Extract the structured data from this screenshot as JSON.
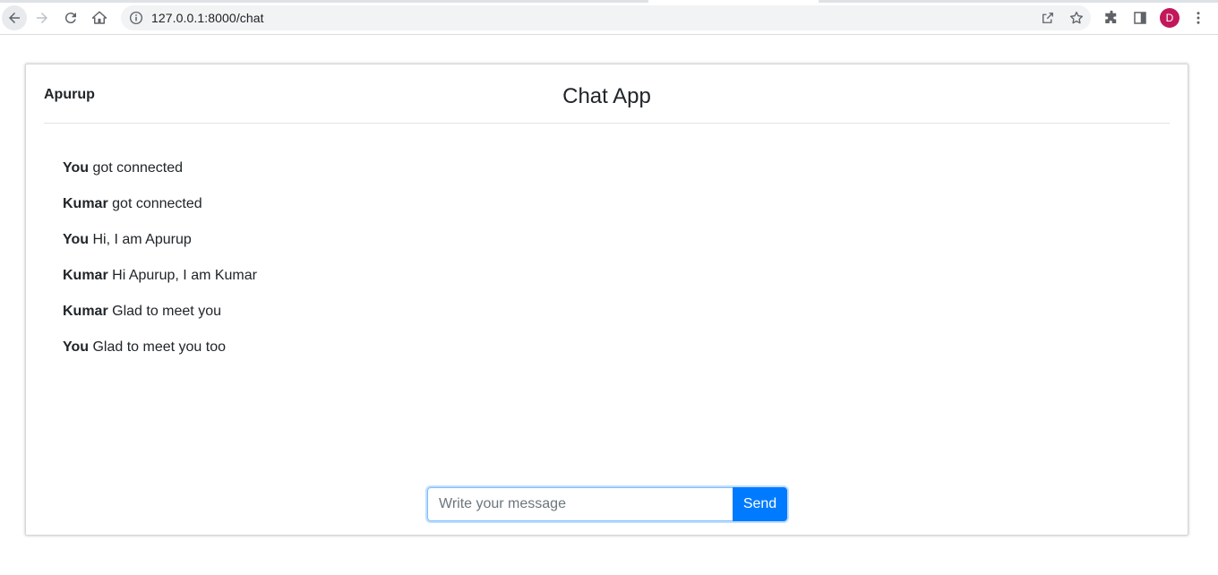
{
  "browser": {
    "url": "127.0.0.1:8000/chat",
    "profile_initial": "D"
  },
  "page": {
    "username": "Apurup",
    "title": "Chat App",
    "messages": [
      {
        "sender": "You",
        "text": "got connected"
      },
      {
        "sender": "Kumar",
        "text": "got connected"
      },
      {
        "sender": "You",
        "text": "Hi, I am Apurup"
      },
      {
        "sender": "Kumar",
        "text": "Hi Apurup, I am Kumar"
      },
      {
        "sender": "Kumar",
        "text": "Glad to meet you"
      },
      {
        "sender": "You",
        "text": "Glad to meet you too"
      }
    ],
    "composer": {
      "placeholder": "Write your message",
      "value": "",
      "send_label": "Send"
    }
  },
  "colors": {
    "accent": "#007bff",
    "avatar": "#c2185b"
  }
}
